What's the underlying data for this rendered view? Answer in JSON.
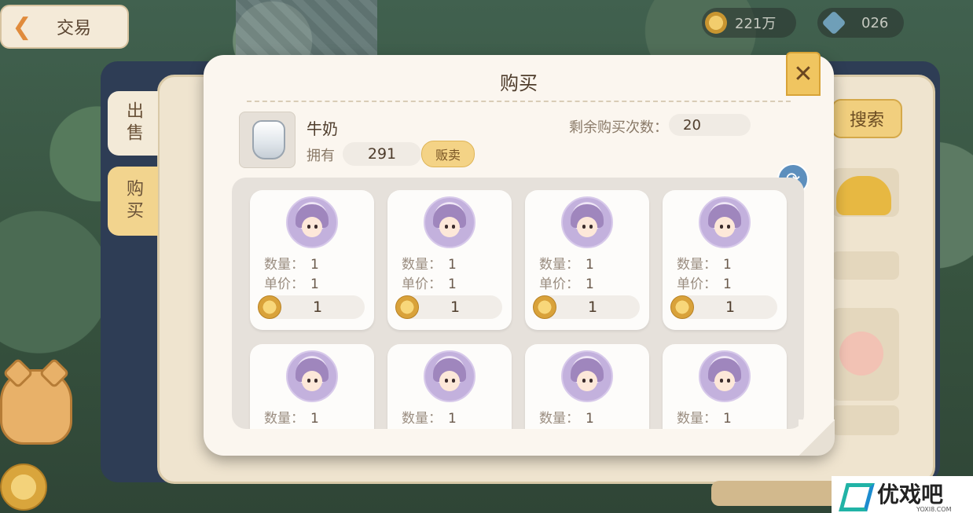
{
  "hud": {
    "back_title": "交易",
    "gold_amount": "221万",
    "gem_amount": "026"
  },
  "trade_panel": {
    "tabs": [
      "出售",
      "购买"
    ],
    "search_label": "搜索"
  },
  "modal": {
    "title": "购买",
    "close_symbol": "✕",
    "item": {
      "name": "牛奶",
      "own_label": "拥有",
      "own_count": "291",
      "sell_label": "贩卖"
    },
    "remaining": {
      "label": "剩余购买次数：",
      "value": "20"
    },
    "refresh_icon": "refresh-icon",
    "listings": [
      {
        "qty_label": "数量：",
        "qty": "1",
        "price_label": "单价：",
        "price": "1",
        "total": "1"
      },
      {
        "qty_label": "数量：",
        "qty": "1",
        "price_label": "单价：",
        "price": "1",
        "total": "1"
      },
      {
        "qty_label": "数量：",
        "qty": "1",
        "price_label": "单价：",
        "price": "1",
        "total": "1"
      },
      {
        "qty_label": "数量：",
        "qty": "1",
        "price_label": "单价：",
        "price": "1",
        "total": "1"
      },
      {
        "qty_label": "数量：",
        "qty": "1"
      },
      {
        "qty_label": "数量：",
        "qty": "1"
      },
      {
        "qty_label": "数量：",
        "qty": "1"
      },
      {
        "qty_label": "数量：",
        "qty": "1"
      }
    ]
  },
  "watermark": {
    "text": "优戏吧",
    "sub": "YOXI8.COM"
  },
  "colors": {
    "modal_bg": "#fbf6ef",
    "accent_gold": "#f0c560",
    "refresh_blue": "#5d8fbd"
  }
}
